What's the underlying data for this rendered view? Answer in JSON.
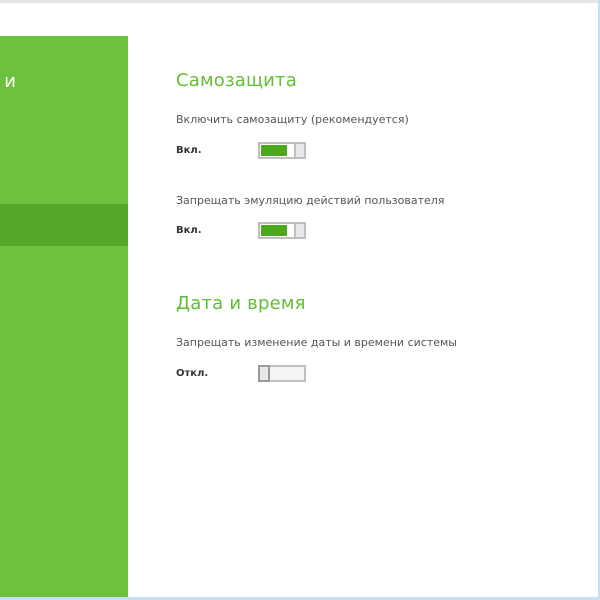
{
  "sidebar": {
    "header_fragment": "и"
  },
  "sections": [
    {
      "title": "Самозащита",
      "options": [
        {
          "label": "Включить самозащиту (рекомендуется)",
          "state": "Вкл.",
          "value": true
        },
        {
          "label": "Запрещать эмуляцию действий пользователя",
          "state": "Вкл.",
          "value": true
        }
      ]
    },
    {
      "title": "Дата и время",
      "options": [
        {
          "label": "Запрещать изменение даты и времени системы",
          "state": "Откл.",
          "value": false
        }
      ]
    }
  ],
  "colors": {
    "sidebar": "#6cc13e",
    "sidebar_selected": "#53a927",
    "accent": "#63bd35",
    "toggle_on": "#4aaa1c"
  }
}
